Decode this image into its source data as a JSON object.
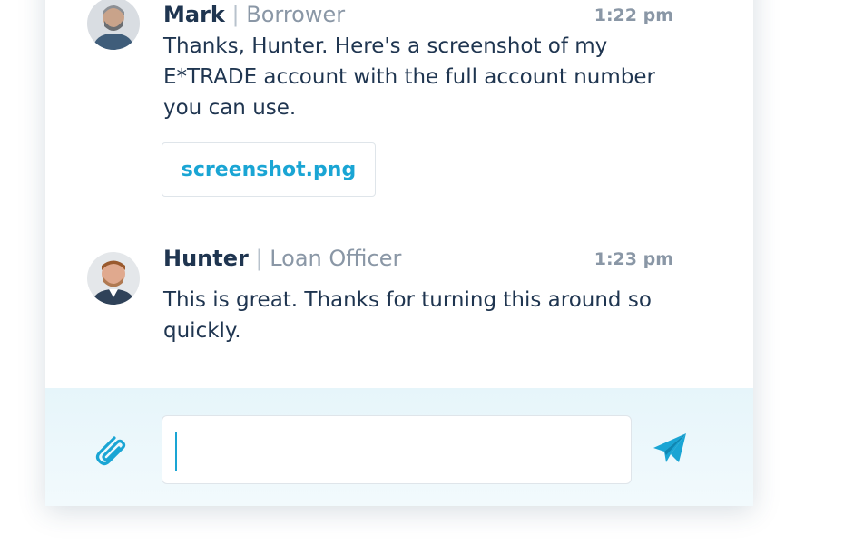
{
  "messages": [
    {
      "sender": "Mark",
      "separator": "|",
      "role": "Borrower",
      "time": "1:22 pm",
      "text": "Thanks, Hunter. Here's a screenshot of my E*TRADE account with the full account number you can use.",
      "attachment": "screenshot.png",
      "avatar_icon": "person-avatar"
    },
    {
      "sender": "Hunter",
      "separator": "|",
      "role": "Loan Officer",
      "time": "1:23 pm",
      "text": "This is great. Thanks for turning this around so quickly.",
      "avatar_icon": "person-avatar"
    }
  ],
  "composer": {
    "input_value": "",
    "attach_icon": "paperclip-icon",
    "send_icon": "paper-plane-icon"
  },
  "colors": {
    "accent": "#1aa5d4",
    "text_dark": "#1f3550",
    "text_muted": "#8a97a6",
    "composer_bg": "#e6f5fa"
  }
}
